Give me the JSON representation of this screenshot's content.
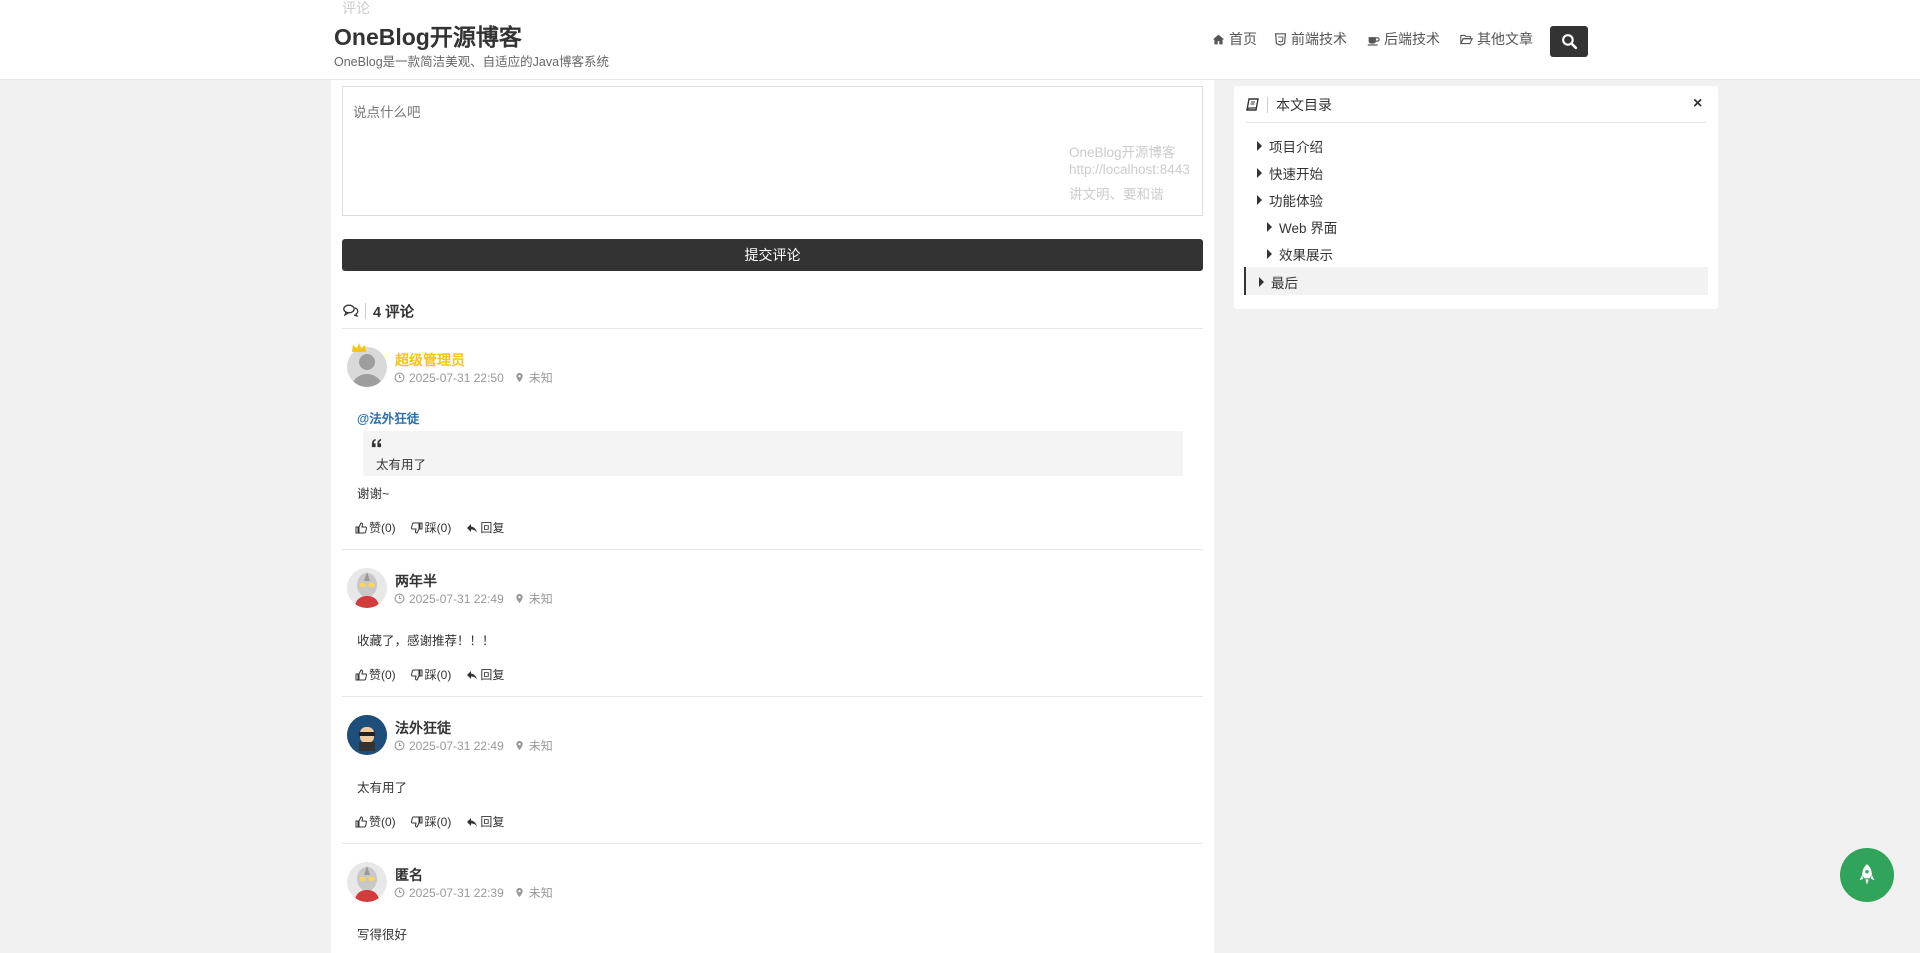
{
  "header": {
    "title": "OneBlog开源博客",
    "subtitle": "OneBlog是一款简洁美观、自适应的Java博客系统",
    "ghost_text": "评论",
    "nav": [
      {
        "label": "首页",
        "icon": "home-icon"
      },
      {
        "label": "前端技术",
        "icon": "css3-icon"
      },
      {
        "label": "后端技术",
        "icon": "coffee-icon"
      },
      {
        "label": "其他文章",
        "icon": "folder-open-icon"
      }
    ],
    "search_icon": "search-icon"
  },
  "comment_form": {
    "placeholder": "说点什么吧",
    "watermark": [
      "OneBlog开源博客",
      "http://localhost:8443",
      "讲文明、要和谐"
    ],
    "submit_label": "提交评论"
  },
  "comments_header": {
    "count_text": "4 评论"
  },
  "comments": [
    {
      "user": "超级管理员",
      "is_admin": true,
      "time": "2025-07-31 22:50",
      "location": "未知",
      "mention": "@法外狂徒",
      "quote": "太有用了",
      "text": "谢谢~",
      "like": "赞(0)",
      "dislike": "踩(0)",
      "reply": "回复"
    },
    {
      "user": "两年半",
      "time": "2025-07-31 22:49",
      "location": "未知",
      "text": "收藏了，感谢推荐！！！",
      "like": "赞(0)",
      "dislike": "踩(0)",
      "reply": "回复"
    },
    {
      "user": "法外狂徒",
      "time": "2025-07-31 22:49",
      "location": "未知",
      "text": "太有用了",
      "like": "赞(0)",
      "dislike": "踩(0)",
      "reply": "回复"
    },
    {
      "user": "匿名",
      "time": "2025-07-31 22:39",
      "location": "未知",
      "text": "写得很好"
    }
  ],
  "toc": {
    "title": "本文目录",
    "close": "×",
    "items": [
      {
        "label": "项目介绍",
        "level": 1
      },
      {
        "label": "快速开始",
        "level": 1
      },
      {
        "label": "功能体验",
        "level": 1
      },
      {
        "label": "Web 界面",
        "level": 2
      },
      {
        "label": "效果展示",
        "level": 2
      },
      {
        "label": "最后",
        "level": 1,
        "active": true
      }
    ]
  },
  "colors": {
    "dark": "#333333",
    "admin_name": "#f5c518",
    "mention": "#2a6fb0",
    "rocket": "#2fa45a",
    "page_bg": "#f1f1f1"
  }
}
